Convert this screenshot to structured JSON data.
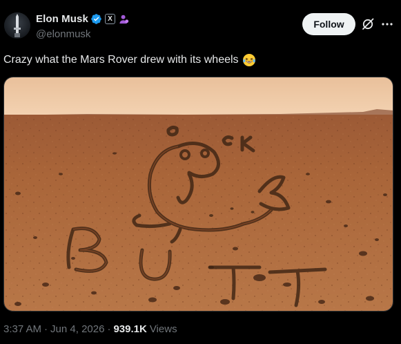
{
  "author": {
    "display_name": "Elon Musk",
    "handle": "@elonmusk",
    "verified_icon": "verified-badge-icon",
    "affiliate_badge": "X",
    "affiliation_icon": "government-affiliation-icon"
  },
  "actions": {
    "follow_label": "Follow",
    "grok_icon": "grok-icon",
    "more_icon": "more-options-icon"
  },
  "tweet": {
    "text": "Crazy what the Mars Rover drew with its wheels",
    "emoji": "laughing-tears-emoji",
    "image_drawing_text": [
      "O",
      "C",
      "K",
      "B",
      "U",
      "T",
      "T"
    ]
  },
  "footer": {
    "time": "3:37 AM",
    "separator": "·",
    "date": "Jun 4, 2026",
    "views_count": "939.1K",
    "views_label": "Views"
  },
  "colors": {
    "background": "#000000",
    "text_primary": "#e7e9ea",
    "text_secondary": "#71767b",
    "verified": "#1d9bf0",
    "follow_bg": "#eff3f4"
  }
}
